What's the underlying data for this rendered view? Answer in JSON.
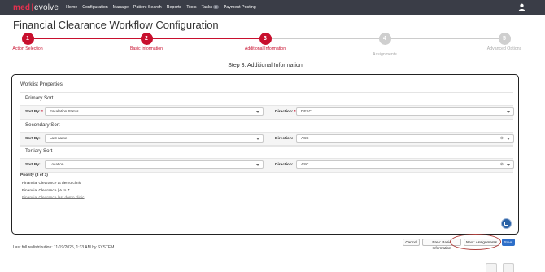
{
  "brand": {
    "part1": "med",
    "separator": "|",
    "part2": "evolve"
  },
  "nav": {
    "items": [
      "Home",
      "Configuration",
      "Manage",
      "Patient Search",
      "Reports",
      "Tools"
    ],
    "tasks_label": "Tasks",
    "tasks_count": "0",
    "payment_label": "Payment Posting",
    "user_icon": "user-icon"
  },
  "page": {
    "title": "Financial Clearance Workflow Configuration",
    "step_heading": "Step 3: Additional Information"
  },
  "steps": [
    {
      "number": "1",
      "label": "Action Selection",
      "state": "active"
    },
    {
      "number": "2",
      "label": "Basic Information",
      "state": "active"
    },
    {
      "number": "3",
      "label": "Additional Information",
      "state": "active"
    },
    {
      "number": "4",
      "label": "Assignments",
      "state": "inactive"
    },
    {
      "number": "5",
      "label": "Advanced Options",
      "state": "inactive"
    }
  ],
  "worklist": {
    "title": "Worklist Properties",
    "primary": {
      "title": "Primary Sort",
      "sort_by_label": "Sort By:",
      "required_mark": "*",
      "sort_by_value": "Escalation Status",
      "direction_label": "Direction:",
      "required_mark_dir": "*",
      "direction_value": "DESC"
    },
    "secondary": {
      "title": "Secondary Sort",
      "sort_by_label": "Sort By:",
      "sort_by_value": "Last name",
      "direction_label": "Direction:",
      "direction_value": "ASC"
    },
    "tertiary": {
      "title": "Tertiary Sort",
      "sort_by_label": "Sort By:",
      "sort_by_value": "Location",
      "direction_label": "Direction:",
      "direction_value": "ASC"
    },
    "priority": {
      "title": "Priority (3 of 3)",
      "items": [
        "Financial Clearance at demo clinic",
        "Financial Clearance | A to Z",
        "Financial Clearance last demo clinic"
      ]
    }
  },
  "footer": {
    "redistribution": "Last full redistribution: 11/19/2025, 1:33 AM by SYSTEM",
    "buttons": {
      "cancel": "Cancel",
      "prev": "Prev: Basic Information",
      "next": "Next: Assignments",
      "save": "Save"
    }
  },
  "colors": {
    "nav_bg": "#3a3d47",
    "accent": "#c8102e",
    "primary_button": "#2e6fc9",
    "inactive_step": "#cfcfcf"
  }
}
